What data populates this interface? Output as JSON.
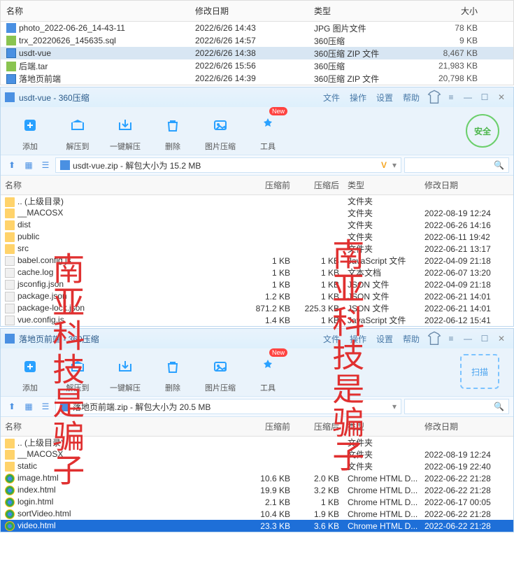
{
  "explorer": {
    "headers": {
      "name": "名称",
      "date": "修改日期",
      "type": "类型",
      "size": "大小"
    },
    "rows": [
      {
        "icon": "fico-jpg",
        "name": "photo_2022-06-26_14-43-11",
        "date": "2022/6/26 14:43",
        "type": "JPG 图片文件",
        "size": "78 KB",
        "sel": false
      },
      {
        "icon": "fico-sql",
        "name": "trx_20220626_145635.sql",
        "date": "2022/6/26 14:57",
        "type": "360压缩",
        "size": "9 KB",
        "sel": false
      },
      {
        "icon": "fico-zip",
        "name": "usdt-vue",
        "date": "2022/6/26 14:38",
        "type": "360压缩 ZIP 文件",
        "size": "8,467 KB",
        "sel": true
      },
      {
        "icon": "fico-tar",
        "name": "后端.tar",
        "date": "2022/6/26 15:56",
        "type": "360压缩",
        "size": "21,983 KB",
        "sel": false
      },
      {
        "icon": "fico-zip",
        "name": "落地页前端",
        "date": "2022/6/26 14:39",
        "type": "360压缩 ZIP 文件",
        "size": "20,798 KB",
        "sel": false
      }
    ]
  },
  "arch1": {
    "title": "usdt-vue - 360压缩",
    "menu": [
      "文件",
      "操作",
      "设置",
      "帮助"
    ],
    "toolbar": [
      {
        "id": "add",
        "label": "添加",
        "color": "#2aa1ff"
      },
      {
        "id": "extract-to",
        "label": "解压到",
        "color": "#2aa1ff"
      },
      {
        "id": "one-click",
        "label": "一键解压",
        "color": "#2aa1ff"
      },
      {
        "id": "delete",
        "label": "删除",
        "color": "#2aa1ff"
      },
      {
        "id": "img-compress",
        "label": "图片压缩",
        "color": "#2aa1ff"
      },
      {
        "id": "tools",
        "label": "工具",
        "color": "#2aa1ff",
        "badge": "New"
      }
    ],
    "safety_label": "安全",
    "path": "usdt-vue.zip - 解包大小为 15.2 MB",
    "chevron": "V",
    "headers": {
      "name": "名称",
      "before": "压缩前",
      "after": "压缩后",
      "type": "类型",
      "date": "修改日期"
    },
    "rows": [
      {
        "icon": "fico-folder",
        "name": ".. (上级目录)",
        "before": "",
        "after": "",
        "type": "文件夹",
        "date": ""
      },
      {
        "icon": "fico-folder",
        "name": "__MACOSX",
        "before": "",
        "after": "",
        "type": "文件夹",
        "date": "2022-08-19 12:24"
      },
      {
        "icon": "fico-folder",
        "name": "dist",
        "before": "",
        "after": "",
        "type": "文件夹",
        "date": "2022-06-26 14:16"
      },
      {
        "icon": "fico-folder",
        "name": "public",
        "before": "",
        "after": "",
        "type": "文件夹",
        "date": "2022-06-11 19:42"
      },
      {
        "icon": "fico-folder",
        "name": "src",
        "before": "",
        "after": "",
        "type": "文件夹",
        "date": "2022-06-21 13:17"
      },
      {
        "icon": "fico-js",
        "name": "babel.config.js",
        "before": "1 KB",
        "after": "1 KB",
        "type": "JavaScript 文件",
        "date": "2022-04-09 21:18"
      },
      {
        "icon": "fico-log",
        "name": "cache.log",
        "before": "1 KB",
        "after": "1 KB",
        "type": "文本文档",
        "date": "2022-06-07 13:20"
      },
      {
        "icon": "fico-json",
        "name": "jsconfig.json",
        "before": "1 KB",
        "after": "1 KB",
        "type": "JSON 文件",
        "date": "2022-04-09 21:18"
      },
      {
        "icon": "fico-json",
        "name": "package.json",
        "before": "1.2 KB",
        "after": "1 KB",
        "type": "JSON 文件",
        "date": "2022-06-21 14:01"
      },
      {
        "icon": "fico-json",
        "name": "package-lock.json",
        "before": "871.2 KB",
        "after": "225.3 KB",
        "type": "JSON 文件",
        "date": "2022-06-21 14:01"
      },
      {
        "icon": "fico-js",
        "name": "vue.config.js",
        "before": "1.4 KB",
        "after": "1 KB",
        "type": "JavaScript 文件",
        "date": "2022-06-12 15:41"
      }
    ]
  },
  "arch2": {
    "title": "落地页前端 - 360压缩",
    "menu": [
      "文件",
      "操作",
      "设置",
      "帮助"
    ],
    "toolbar": [
      {
        "id": "add",
        "label": "添加"
      },
      {
        "id": "extract-to",
        "label": "解压到"
      },
      {
        "id": "one-click",
        "label": "一键解压"
      },
      {
        "id": "delete",
        "label": "删除"
      },
      {
        "id": "img-compress",
        "label": "图片压缩"
      },
      {
        "id": "tools",
        "label": "工具",
        "badge": "New"
      }
    ],
    "scan_label": "扫描",
    "path": "落地页前端.zip - 解包大小为 20.5 MB",
    "headers": {
      "name": "名称",
      "before": "压缩前",
      "after": "压缩后",
      "type": "类型",
      "date": "修改日期"
    },
    "rows": [
      {
        "icon": "fico-folder",
        "name": ".. (上级目录)",
        "before": "",
        "after": "",
        "type": "文件夹",
        "date": ""
      },
      {
        "icon": "fico-folder",
        "name": "__MACOSX",
        "before": "",
        "after": "",
        "type": "文件夹",
        "date": "2022-08-19 12:24"
      },
      {
        "icon": "fico-folder",
        "name": "static",
        "before": "",
        "after": "",
        "type": "文件夹",
        "date": "2022-06-19 22:40"
      },
      {
        "icon": "fico-chrome",
        "name": "image.html",
        "before": "10.6 KB",
        "after": "2.0 KB",
        "type": "Chrome HTML D...",
        "date": "2022-06-22 21:28"
      },
      {
        "icon": "fico-chrome",
        "name": "index.html",
        "before": "19.9 KB",
        "after": "3.2 KB",
        "type": "Chrome HTML D...",
        "date": "2022-06-22 21:28"
      },
      {
        "icon": "fico-chrome",
        "name": "login.html",
        "before": "2.1 KB",
        "after": "1 KB",
        "type": "Chrome HTML D...",
        "date": "2022-06-17 00:05"
      },
      {
        "icon": "fico-chrome",
        "name": "sortVideo.html",
        "before": "10.4 KB",
        "after": "1.9 KB",
        "type": "Chrome HTML D...",
        "date": "2022-06-22 21:28"
      },
      {
        "icon": "fico-chrome",
        "name": "video.html",
        "before": "23.3 KB",
        "after": "3.6 KB",
        "type": "Chrome HTML D...",
        "date": "2022-06-22 21:28",
        "sel": true
      }
    ]
  },
  "watermark": "南亚科技是骗子"
}
